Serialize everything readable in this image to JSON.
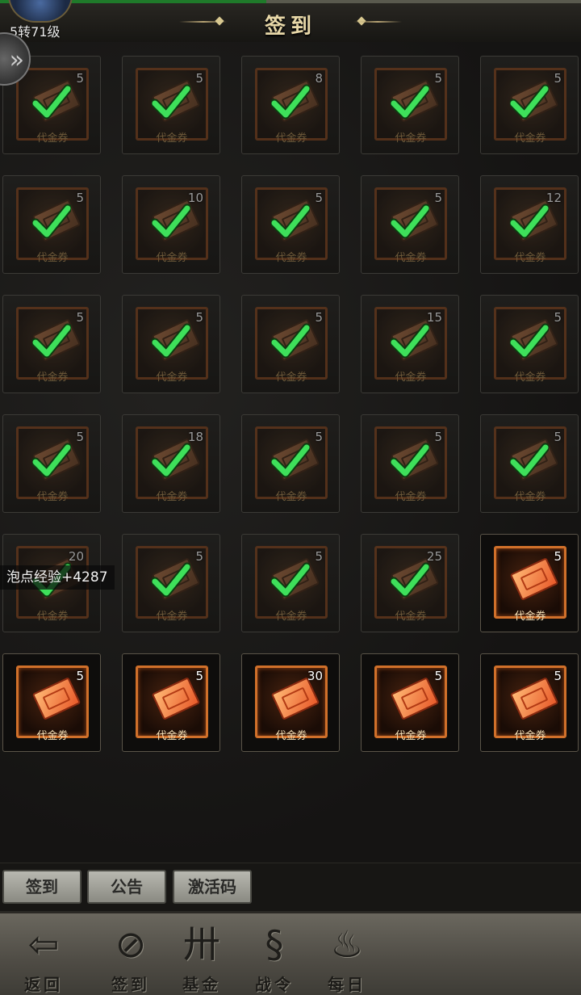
{
  "header": {
    "level": "5转71级",
    "title": "签到"
  },
  "side_button_icon": "double-chevron-icon",
  "grid": {
    "item_label": "代金券",
    "items": [
      {
        "count": "5",
        "claimed": true
      },
      {
        "count": "5",
        "claimed": true
      },
      {
        "count": "8",
        "claimed": true
      },
      {
        "count": "5",
        "claimed": true
      },
      {
        "count": "5",
        "claimed": true
      },
      {
        "count": "5",
        "claimed": true
      },
      {
        "count": "10",
        "claimed": true
      },
      {
        "count": "5",
        "claimed": true
      },
      {
        "count": "5",
        "claimed": true
      },
      {
        "count": "12",
        "claimed": true
      },
      {
        "count": "5",
        "claimed": true
      },
      {
        "count": "5",
        "claimed": true
      },
      {
        "count": "5",
        "claimed": true
      },
      {
        "count": "15",
        "claimed": true
      },
      {
        "count": "5",
        "claimed": true
      },
      {
        "count": "5",
        "claimed": true
      },
      {
        "count": "18",
        "claimed": true
      },
      {
        "count": "5",
        "claimed": true
      },
      {
        "count": "5",
        "claimed": true
      },
      {
        "count": "5",
        "claimed": true
      },
      {
        "count": "20",
        "claimed": true
      },
      {
        "count": "5",
        "claimed": true
      },
      {
        "count": "5",
        "claimed": true
      },
      {
        "count": "25",
        "claimed": true
      },
      {
        "count": "5",
        "claimed": false
      },
      {
        "count": "5",
        "claimed": false
      },
      {
        "count": "5",
        "claimed": false
      },
      {
        "count": "30",
        "claimed": false
      },
      {
        "count": "5",
        "claimed": false
      },
      {
        "count": "5",
        "claimed": false
      }
    ]
  },
  "float_text": "泡点经验+4287",
  "tabs": [
    {
      "label": "签到"
    },
    {
      "label": "公告"
    },
    {
      "label": "激活码"
    }
  ],
  "bottom_nav": [
    {
      "label": "返回",
      "icon": "back-arrow-icon"
    },
    {
      "label": "签到",
      "icon": "sign-in-brush-icon"
    },
    {
      "label": "基金",
      "icon": "fund-icon"
    },
    {
      "label": "战令",
      "icon": "scroll-icon"
    },
    {
      "label": "每日",
      "icon": "daily-book-icon"
    }
  ]
}
